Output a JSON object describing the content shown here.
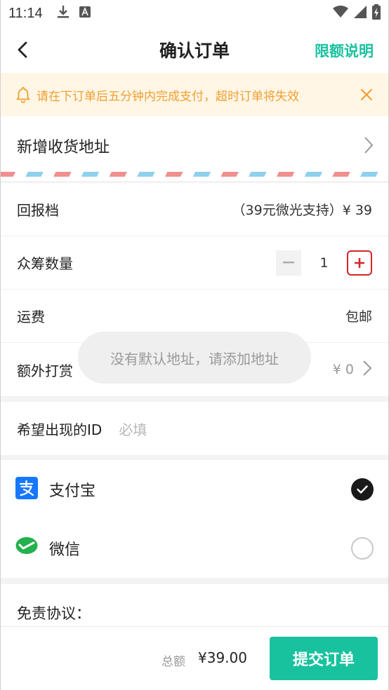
{
  "status_bar": {
    "time": "11:14",
    "icons": [
      "download-icon",
      "a-icon",
      "wifi-icon",
      "signal-icon",
      "battery-icon"
    ]
  },
  "header": {
    "title": "确认订单",
    "right_link": "限额说明"
  },
  "notice": {
    "text": "请在下订单后五分钟内完成支付，超时订单将失效"
  },
  "address": {
    "label": "新增收货地址"
  },
  "rows": {
    "reward_tier": {
      "label": "回报档",
      "value": "（39元微光支持）¥ 39"
    },
    "quantity": {
      "label": "众筹数量",
      "value": "1"
    },
    "shipping": {
      "label": "运费",
      "value": "包邮"
    },
    "tip": {
      "label": "额外打赏",
      "value": "¥ 0"
    }
  },
  "id_field": {
    "label": "希望出现的ID",
    "placeholder": "必填"
  },
  "payment": {
    "alipay": {
      "label": "支付宝",
      "selected": true
    },
    "wechat": {
      "label": "微信",
      "selected": false
    }
  },
  "disclaimer": {
    "label": "免责协议："
  },
  "bottom": {
    "total_label": "总额",
    "total_value": "¥39.00",
    "submit_label": "提交订单"
  },
  "toast": {
    "text": "没有默认地址，请添加地址"
  },
  "colors": {
    "accent": "#19c2a0",
    "notice_text": "#f0a030",
    "notice_bg": "#fff6e6",
    "plus_border": "#d0262b",
    "alipay": "#1677ff",
    "wechat": "#22b14c"
  }
}
